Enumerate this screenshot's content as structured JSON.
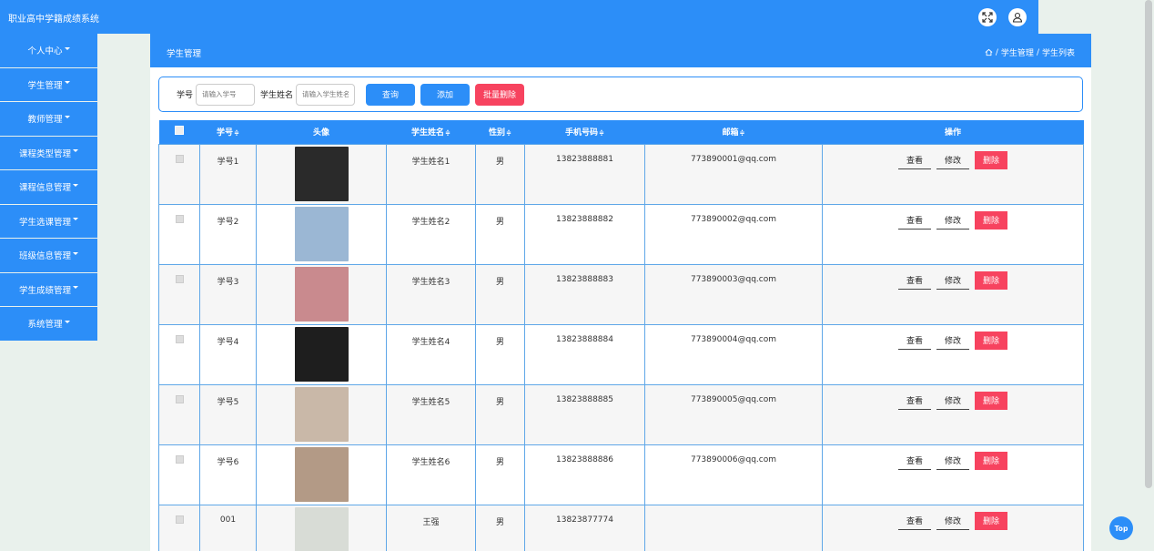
{
  "app": {
    "title": "职业高中学籍成绩系统"
  },
  "header": {
    "fullscreen_icon": "expand-icon",
    "user_icon": "user-icon"
  },
  "sidebar": {
    "items": [
      {
        "label": "个人中心"
      },
      {
        "label": "学生管理"
      },
      {
        "label": "教师管理"
      },
      {
        "label": "课程类型管理"
      },
      {
        "label": "课程信息管理"
      },
      {
        "label": "学生选课管理"
      },
      {
        "label": "班级信息管理"
      },
      {
        "label": "学生成绩管理"
      },
      {
        "label": "系统管理"
      }
    ]
  },
  "page": {
    "title": "学生管理",
    "breadcrumb": {
      "home_icon": "home-icon",
      "sep": "/",
      "level1": "学生管理",
      "level2": "学生列表"
    }
  },
  "search": {
    "student_id_label": "学号",
    "student_id_placeholder": "请输入学号",
    "student_name_label": "学生姓名",
    "student_name_placeholder": "请输入学生姓名",
    "query_label": "查询",
    "add_label": "添加",
    "batch_delete_label": "批量删除"
  },
  "table": {
    "columns": [
      "学号",
      "头像",
      "学生姓名",
      "性别",
      "手机号码",
      "邮箱",
      "操作"
    ],
    "sort_glyph": "≑",
    "actions": {
      "view": "查看",
      "edit": "修改",
      "delete": "删除"
    },
    "rows": [
      {
        "id": "学号1",
        "name": "学生姓名1",
        "gender": "男",
        "phone": "13823888881",
        "email": "773890001@qq.com",
        "avatar_color": "#2a2a2a"
      },
      {
        "id": "学号2",
        "name": "学生姓名2",
        "gender": "男",
        "phone": "13823888882",
        "email": "773890002@qq.com",
        "avatar_color": "#9bb7d4"
      },
      {
        "id": "学号3",
        "name": "学生姓名3",
        "gender": "男",
        "phone": "13823888883",
        "email": "773890003@qq.com",
        "avatar_color": "#c98a8e"
      },
      {
        "id": "学号4",
        "name": "学生姓名4",
        "gender": "男",
        "phone": "13823888884",
        "email": "773890004@qq.com",
        "avatar_color": "#1e1e1e"
      },
      {
        "id": "学号5",
        "name": "学生姓名5",
        "gender": "男",
        "phone": "13823888885",
        "email": "773890005@qq.com",
        "avatar_color": "#c9b8a8"
      },
      {
        "id": "学号6",
        "name": "学生姓名6",
        "gender": "男",
        "phone": "13823888886",
        "email": "773890006@qq.com",
        "avatar_color": "#b39a86"
      },
      {
        "id": "001",
        "name": "王强",
        "gender": "男",
        "phone": "13823877774",
        "email": "",
        "avatar_color": "#d8dcd6"
      }
    ]
  },
  "top_button": {
    "label": "Top"
  }
}
